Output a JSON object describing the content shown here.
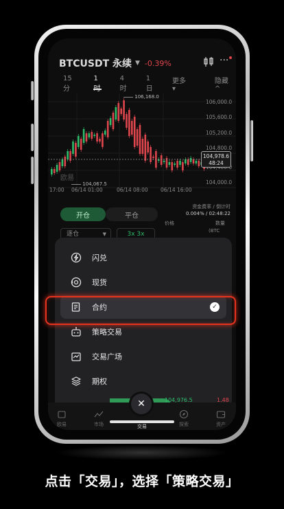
{
  "header": {
    "pair": "BTCUSDT 永续",
    "change": "-0.39%",
    "chart_icon": "candlestick-chart-icon",
    "more_icon": "more-dots-icon"
  },
  "timeframes": {
    "items": [
      "15分",
      "1时",
      "4时",
      "1日",
      "更多 ▾"
    ],
    "active": "1时",
    "hide": "隐藏 ^"
  },
  "chart_data": {
    "type": "candlestick",
    "y_ticks": [
      "106,000.0",
      "105,600.0",
      "105,200.0",
      "104,800.0",
      "104,400.0",
      "104,000.0"
    ],
    "x_ticks": [
      "17:00",
      "06/14 01:00",
      "06/14 08:00",
      "06/14 16:00"
    ],
    "high_label": "106,168.0",
    "low_label": "104,067.5",
    "last_price": "104,978.6",
    "countdown": "48:24",
    "watermark": "欧易"
  },
  "trade": {
    "open": "开仓",
    "close": "平仓",
    "funding_title": "资金费率 / 倒计时",
    "funding_value": "0.004% / 02:48:22",
    "order_type": "逐仓",
    "leverage": "3x  3x",
    "price_label": "价格",
    "qty_label": "数量",
    "qty_unit": "(BTC",
    "bottom_price": "104,976.5",
    "bottom_qty": "1.48"
  },
  "menu": {
    "items": [
      {
        "label": "闪兑",
        "icon": "lightning-icon"
      },
      {
        "label": "现货",
        "icon": "spot-cycle-icon"
      },
      {
        "label": "合约",
        "icon": "contract-doc-icon",
        "selected": true
      },
      {
        "label": "策略交易",
        "icon": "robot-icon"
      },
      {
        "label": "交易广场",
        "icon": "trading-square-icon"
      },
      {
        "label": "期权",
        "icon": "options-layers-icon"
      }
    ]
  },
  "nav": {
    "items": [
      "欧易",
      "市场",
      "交易",
      "探索",
      "资产"
    ],
    "close_glyph": "✕"
  },
  "caption": "点击「交易」，选择「策略交易」",
  "colors": {
    "up": "#2ebd6b",
    "down": "#e0464e",
    "highlight": "#e8341f"
  }
}
